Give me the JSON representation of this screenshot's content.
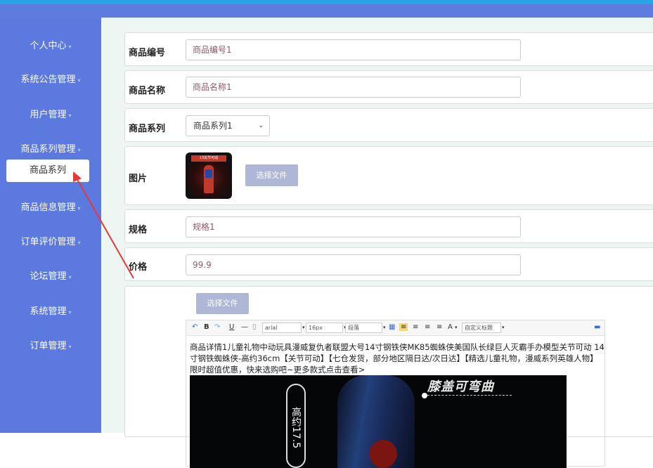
{
  "sidebar": {
    "items": [
      {
        "label": "个人中心"
      },
      {
        "label": "系统公告管理"
      },
      {
        "label": "用户管理"
      },
      {
        "label": "商品系列管理"
      },
      {
        "label": "商品信息管理"
      },
      {
        "label": "订单评价管理"
      },
      {
        "label": "论坛管理"
      },
      {
        "label": "系统管理"
      },
      {
        "label": "订单管理"
      }
    ],
    "active_sub": "商品系列",
    "caret": "▾"
  },
  "form": {
    "code": {
      "label": "商品编号",
      "value": "商品编号1"
    },
    "name": {
      "label": "商品名称",
      "value": "商品名称1"
    },
    "series": {
      "label": "商品系列",
      "value": "商品系列1"
    },
    "image": {
      "label": "图片",
      "button": "选择文件",
      "thumb_text": "13关节可动"
    },
    "spec": {
      "label": "规格",
      "value": "规格1"
    },
    "price": {
      "label": "价格",
      "value": "99.9"
    },
    "detail": {
      "button": "选择文件"
    }
  },
  "editor": {
    "toolbar": {
      "font_family": "arial",
      "font_size": "16px",
      "paragraph": "段落",
      "custom_title": "自定义标题",
      "bold": "B",
      "italic": "I",
      "underline": "U",
      "hr": "—",
      "font_color": "A"
    },
    "content": "商品详情1儿童礼物中动玩具漫威复仇者联盟大号14寸钢铁侠MK85蜘蛛侠美国队长绿巨人灭霸手办模型关节可动 14寸钢铁蜘蛛侠-高约36cm【关节可动】【七仓发货，部分地区隔日达/次日达】【精选儿童礼物，漫威系列英雄人物】限时超值优惠，快来选购吧~更多款式点击查看>",
    "promo_headline": "膝盖可弯曲",
    "promo_height": "高约17.5"
  },
  "colors": {
    "sidebar": "#5c79e0",
    "topbar": "#2aa4e6",
    "content_bg": "#eef6f3",
    "button": "#aeb8d6",
    "arrow": "#e53935"
  }
}
